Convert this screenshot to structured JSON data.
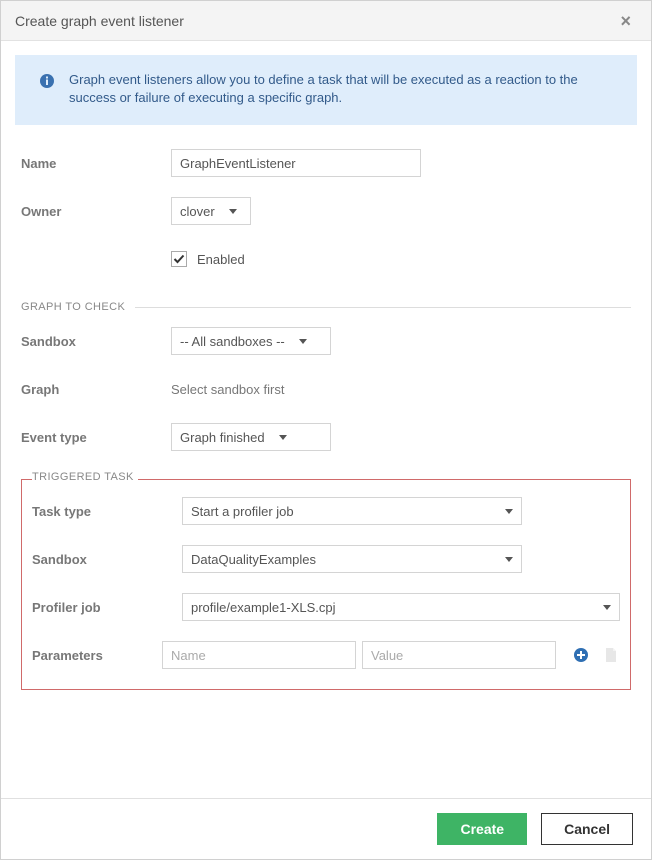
{
  "dialog": {
    "title": "Create graph event listener",
    "info": "Graph event listeners allow you to define a task that will be executed as a reaction to the success or failure of executing a specific graph."
  },
  "labels": {
    "name": "Name",
    "owner": "Owner",
    "enabled": "Enabled",
    "graph_to_check": "GRAPH TO CHECK",
    "sandbox": "Sandbox",
    "graph": "Graph",
    "event_type": "Event type",
    "triggered_task": "TRIGGERED TASK",
    "task_type": "Task type",
    "sandbox2": "Sandbox",
    "profiler_job": "Profiler job",
    "parameters": "Parameters"
  },
  "values": {
    "name": "GraphEventListener",
    "owner": "clover",
    "enabled": true,
    "sandbox": "-- All sandboxes --",
    "graph_hint": "Select sandbox first",
    "event_type": "Graph finished",
    "task_type": "Start a profiler job",
    "task_sandbox": "DataQualityExamples",
    "profiler_job": "profile/example1-XLS.cpj"
  },
  "placeholders": {
    "param_name": "Name",
    "param_value": "Value"
  },
  "buttons": {
    "create": "Create",
    "cancel": "Cancel"
  },
  "icons": {
    "close": "close-icon",
    "info": "info-icon",
    "caret": "caret-down-icon",
    "check": "check-icon",
    "add": "plus-circle-icon",
    "file": "file-icon"
  }
}
